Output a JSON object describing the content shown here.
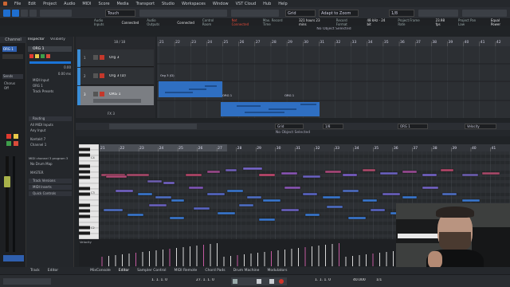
{
  "menu": [
    "File",
    "Edit",
    "Project",
    "Audio",
    "MIDI",
    "Score",
    "Media",
    "Transport",
    "Studio",
    "Workspaces",
    "Window",
    "VST Cloud",
    "Hub",
    "Help"
  ],
  "toolbar": {
    "mode": "Touch",
    "grid": "Grid",
    "zoom": "Adapt to Zoom",
    "quant": "1/8"
  },
  "status": {
    "audio_inputs": "Audio Inputs",
    "inputs_state": "Connected",
    "audio_outputs": "Audio Outputs",
    "outputs_state": "Connected",
    "control_room": "Control Room",
    "cr_state": "Not Connected",
    "max_record": "Max. Record Time",
    "max_record_val": "321 hours 23 mins",
    "record_format": "Record Format",
    "record_format_val": "48 kHz - 24 bit",
    "frame_rate": "Project Frame Rate",
    "frame_rate_val": "23.98 fps",
    "pan_law": "Project Pan Law",
    "pan_law_val": "Equal Power"
  },
  "no_object": "No Object Selected",
  "zone": {
    "channel_tab": "Channel",
    "inspector_tab": "Inspector",
    "visibility_tab": "Visibility",
    "track_name": "ORG 1",
    "sends": "Sends",
    "chorus": "Chorus",
    "off": "Off",
    "track_values": [
      "0.00",
      "0.00 ms"
    ],
    "midi_in": "MIDI Input",
    "midi_port": "ORG 1",
    "track_presets": "Track Presets",
    "routing": "Routing",
    "all_midi": "All MIDI Inputs",
    "any_input": "Any Input",
    "kontakt": "Kontakt 7",
    "channel": "Channel 1",
    "midi_chan": "MIDI channel 3 program 3",
    "no_drum": "No Drum Map",
    "master": "MASTER",
    "track_versions": "Track Versions",
    "midi_inserts": "MIDI Inserts",
    "quick_controls": "Quick Controls"
  },
  "tracks": [
    {
      "n": "1",
      "name": "Org 3"
    },
    {
      "n": "2",
      "name": "Org 3 (D)"
    },
    {
      "n": "3",
      "name": "ORG 1"
    }
  ],
  "fx_label": "FX 3",
  "track_counter": "18 / 18",
  "ruler": [
    "21",
    "22",
    "23",
    "24",
    "25",
    "26",
    "27",
    "28",
    "29",
    "30",
    "31",
    "32",
    "33",
    "34",
    "35",
    "36",
    "37",
    "38",
    "39",
    "40",
    "41",
    "42"
  ],
  "parts": [
    {
      "name": "Org 3 (D)"
    },
    {
      "name": "ORG 1"
    },
    {
      "name": "ORG 1"
    }
  ],
  "lower": {
    "grid": "Grid",
    "quant": "1/8",
    "track": "ORG 1",
    "velocity": "Velocity",
    "header": "No Object Selected"
  },
  "pr_ruler": [
    "21",
    "22",
    "23",
    "24",
    "25",
    "26",
    "27",
    "28",
    "29",
    "30",
    "31",
    "32",
    "33",
    "34",
    "35",
    "36",
    "37",
    "38",
    "39",
    "40",
    "41"
  ],
  "kbd_labels": [
    "C4",
    "C3",
    "C2"
  ],
  "velocity_label": "Velocity",
  "bottom": [
    "Track",
    "Editor",
    "MixConsole",
    "Editor",
    "Sampler Control",
    "MIDI Remote",
    "Chord Pads",
    "Drum Machine",
    "Modulators"
  ],
  "transport": {
    "left_pos": "1. 1. 1. 0",
    "right_pos": "27. 1. 1. 0",
    "pos2": "1. 1. 1. 0",
    "tempo": "40.000",
    "tempo2": "1/1"
  }
}
